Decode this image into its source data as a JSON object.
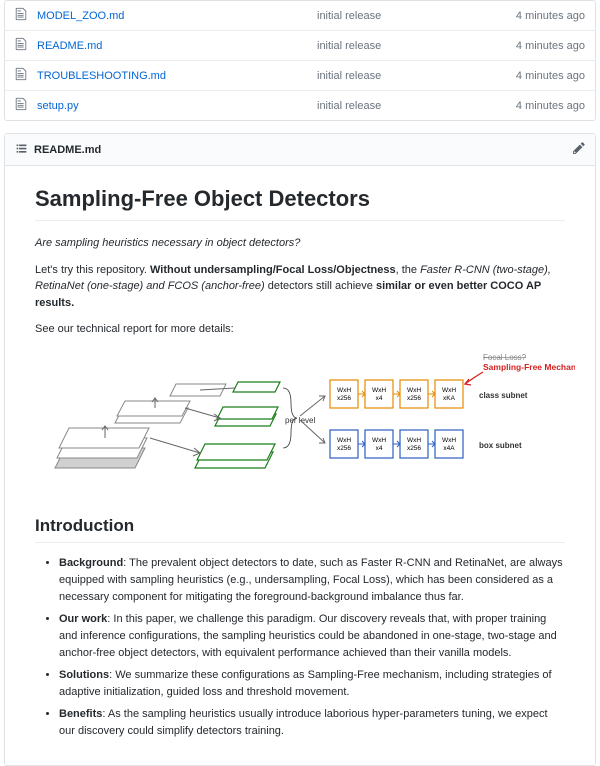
{
  "files": [
    {
      "name": "MODEL_ZOO.md",
      "msg": "initial release",
      "time": "4 minutes ago"
    },
    {
      "name": "README.md",
      "msg": "initial release",
      "time": "4 minutes ago"
    },
    {
      "name": "TROUBLESHOOTING.md",
      "msg": "initial release",
      "time": "4 minutes ago"
    },
    {
      "name": "setup.py",
      "msg": "initial release",
      "time": "4 minutes ago"
    }
  ],
  "readme": {
    "filename": "README.md",
    "title": "Sampling-Free Object Detectors",
    "intro_q": "Are sampling heuristics necessary in object detectors?",
    "intro_p1a": "Let's try this repository. ",
    "intro_p1b": "Without undersampling/Focal Loss/Objectness",
    "intro_p1c": ", the ",
    "intro_p1d": "Faster R-CNN (two-stage), RetinaNet (one-stage) and FCOS (anchor-free)",
    "intro_p1e": " detectors still achieve ",
    "intro_p1f": "similar or even better COCO AP results.",
    "intro_p2": "See our technical report for more details:",
    "h2_intro": "Introduction",
    "bullets": [
      {
        "label": "Background",
        "text": ": The prevalent object detectors to date, such as Faster R-CNN and RetinaNet, are always equipped with sampling heuristics (e.g., undersampling, Focal Loss), which has been considered as a necessary component for mitigating the foreground-background imbalance thus far."
      },
      {
        "label": "Our work",
        "text": ": In this paper, we challenge this paradigm. Our discovery reveals that, with proper training and inference configurations, the sampling heuristics could be abandoned in one-stage, two-stage and anchor-free object detectors, with equivalent performance achieved than their vanilla models."
      },
      {
        "label": "Solutions",
        "text": ": We summarize these configurations as Sampling-Free mechanism, including strategies of adaptive initialization, guided loss and threshold movement."
      },
      {
        "label": "Benefits",
        "text": ": As the sampling heuristics usually introduce laborious hyper-parameters tuning, we expect our discovery could simplify detectors training."
      }
    ],
    "diagram": {
      "per_level": "per level",
      "focal_loss": "Focal Loss?",
      "sampling_free": "Sampling-Free Mechanism",
      "class_subnet": "class subnet",
      "box_subnet": "box subnet",
      "blocks": {
        "wh256": "WxH\nx256",
        "wh4": "WxH\nx4",
        "whka": "WxH\nxKA",
        "wh4a": "WxH\nx4A"
      }
    }
  }
}
